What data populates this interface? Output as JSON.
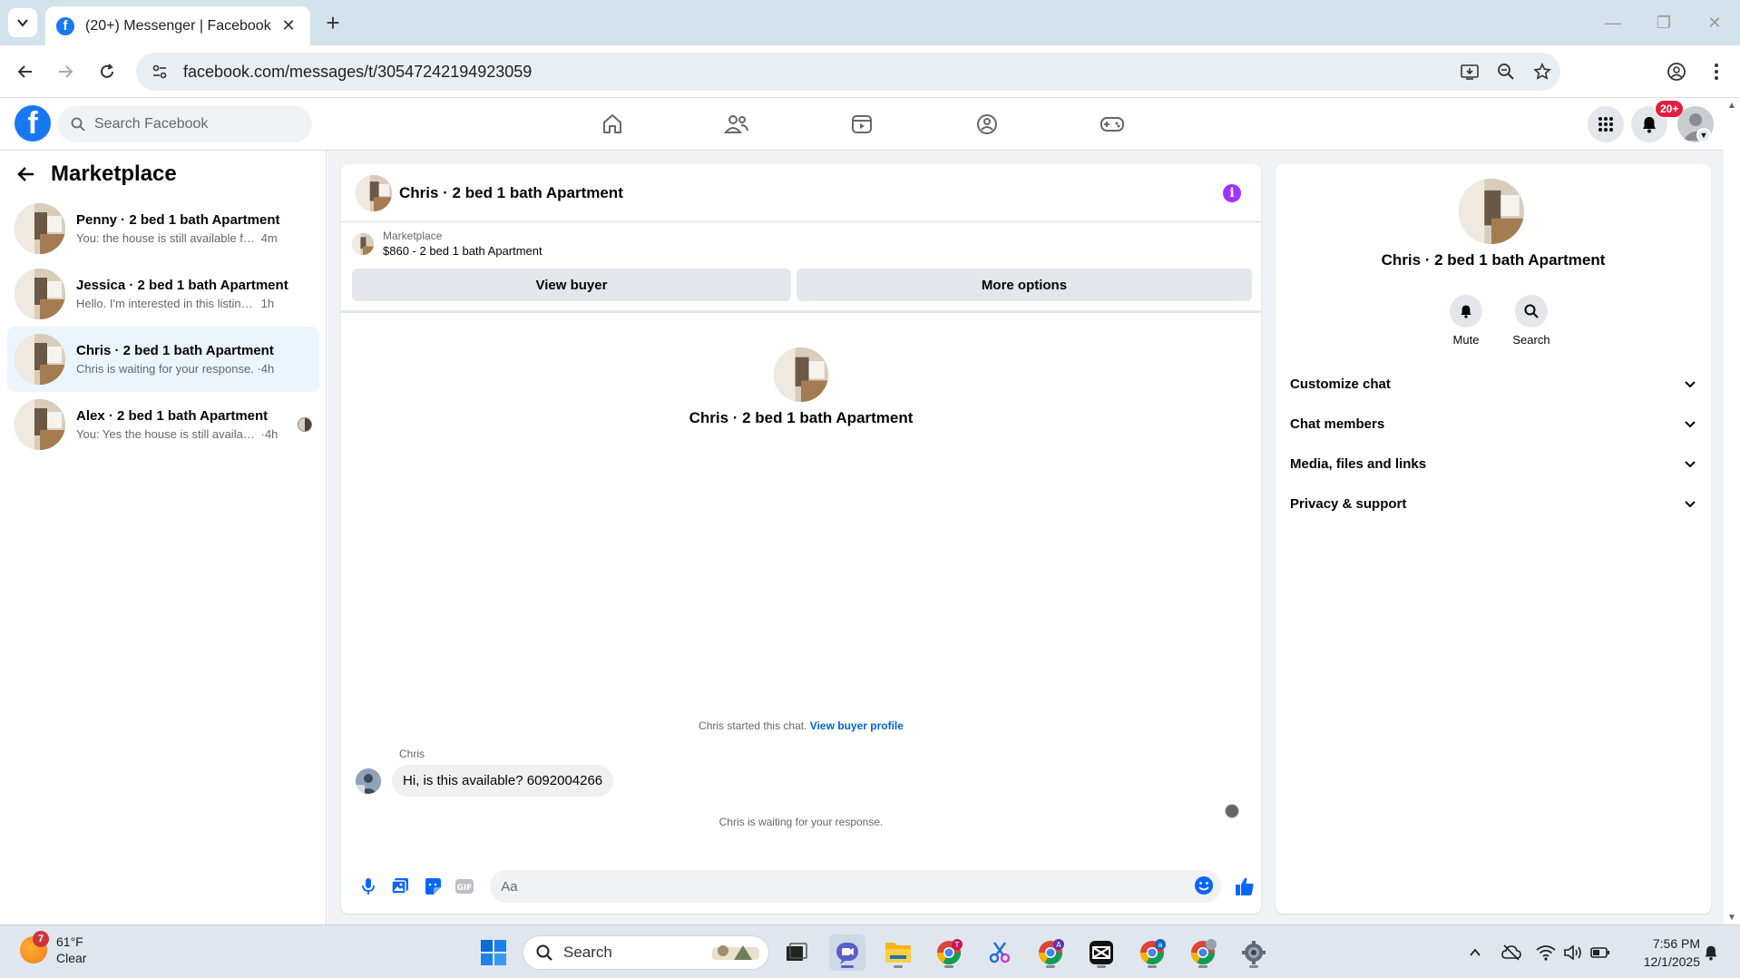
{
  "browser": {
    "tab_title": "(20+) Messenger | Facebook",
    "url": "facebook.com/messages/t/30547242194923059"
  },
  "fb": {
    "search_placeholder": "Search Facebook",
    "notif_count": "20+"
  },
  "left": {
    "title": "Marketplace",
    "conversations": [
      {
        "name": "Penny · 2 bed 1 bath Apartment",
        "preview": "You: the house is still available for ren...",
        "time": "4m",
        "active": false
      },
      {
        "name": "Jessica · 2 bed 1 bath Apartment",
        "preview": "Hello. I'm interested in this listing. Can...",
        "time": "1h",
        "active": false
      },
      {
        "name": "Chris · 2 bed 1 bath Apartment",
        "preview": "Chris is waiting for your response.",
        "time": "4h",
        "active": true
      },
      {
        "name": "Alex · 2 bed 1 bath Apartment",
        "preview": "You: Yes the house is still available ...",
        "time": "4h",
        "active": false
      }
    ]
  },
  "chat": {
    "title": "Chris · 2 bed 1 bath Apartment",
    "listing_source": "Marketplace",
    "listing_title": "$860 - 2 bed 1 bath Apartment",
    "view_buyer": "View buyer",
    "more_options": "More options",
    "intro_name": "Chris · 2 bed 1 bath Apartment",
    "started_text": "Chris started this chat.",
    "buyer_profile_link": "View buyer profile",
    "sender": "Chris",
    "message": "Hi, is this available? 6092004266",
    "waiting_text": "Chris is waiting for your response.",
    "composer_placeholder": "Aa"
  },
  "right": {
    "name": "Chris · 2 bed 1 bath Apartment",
    "actions": {
      "mute": "Mute",
      "search": "Search"
    },
    "sections": [
      "Customize chat",
      "Chat members",
      "Media, files and links",
      "Privacy & support"
    ]
  },
  "taskbar": {
    "weather_temp": "61°F",
    "weather_desc": "Clear",
    "weather_badge": "7",
    "search_label": "Search",
    "time": "7:56 PM",
    "date": "12/1/2025"
  },
  "colors": {
    "fb_blue": "#1877f2",
    "active_row": "#ebf5ff",
    "info_purple": "#a033ff",
    "badge_red": "#e41e3f"
  }
}
